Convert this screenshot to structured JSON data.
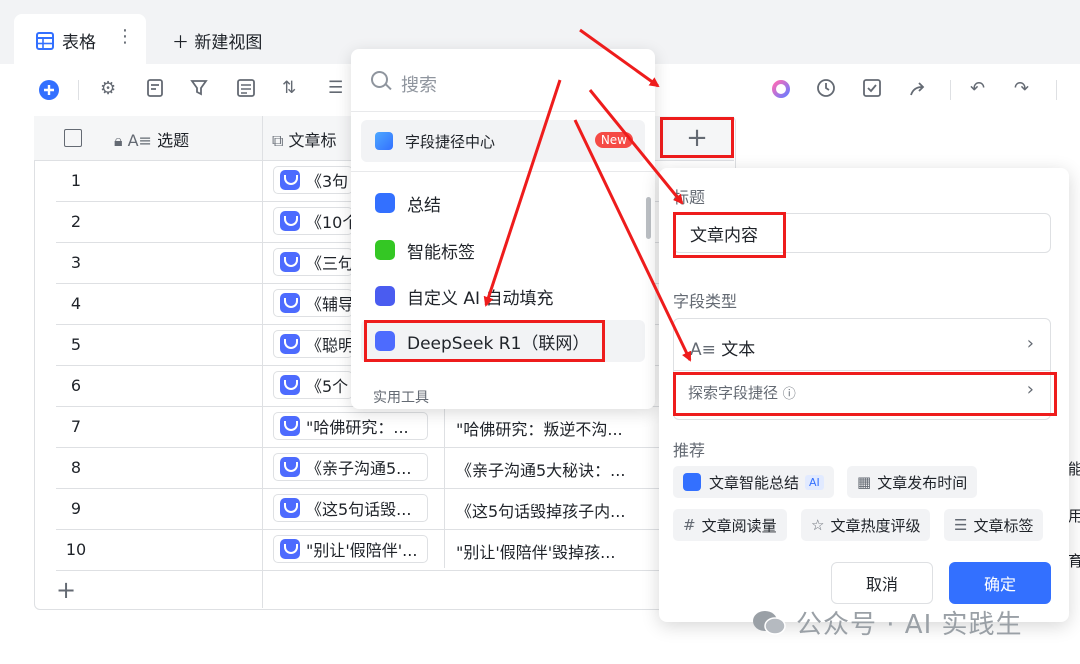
{
  "tabs": {
    "active_label": "表格",
    "new_view_label": "新建视图"
  },
  "table": {
    "header_topic": "选题",
    "header_title": "文章标",
    "rows": [
      {
        "num": "1",
        "title": "《3句"
      },
      {
        "num": "2",
        "title": "《10个"
      },
      {
        "num": "3",
        "title": "《三句"
      },
      {
        "num": "4",
        "title": "《辅导"
      },
      {
        "num": "5",
        "title": "《聪明"
      },
      {
        "num": "6",
        "title": "《5个"
      },
      {
        "num": "7",
        "title": "\"哈佛研究：...",
        "content": "\"哈佛研究：叛逆不沟..."
      },
      {
        "num": "8",
        "title": "《亲子沟通5...",
        "content": "《亲子沟通5大秘诀：..."
      },
      {
        "num": "9",
        "title": "《这5句话毁...",
        "content": "《这5句话毁掉孩子内..."
      },
      {
        "num": "10",
        "title": "\"别让'假陪伴'...",
        "content": "\"别让'假陪伴'毁掉孩..."
      }
    ],
    "add_row": "+",
    "clipped_right": [
      "能",
      "用",
      "育"
    ]
  },
  "menu": {
    "search_placeholder": "搜索",
    "center": "字段捷径中心",
    "new_badge": "New",
    "items": [
      "总结",
      "智能标签",
      "自定义 AI 自动填充",
      "DeepSeek R1（联网）"
    ],
    "section": "实用工具"
  },
  "add_column": "+",
  "panel": {
    "title_label": "标题",
    "title_value": "文章内容",
    "type_label": "字段类型",
    "type_value": "文本",
    "explore": "探索字段捷径",
    "recommend_label": "推荐",
    "recommendations": [
      "文章智能总结",
      "文章发布时间",
      "文章阅读量",
      "文章热度评级",
      "文章标签"
    ],
    "ai_tag": "AI",
    "cancel": "取消",
    "confirm": "确定"
  },
  "watermark": "公众号 · AI 实践生",
  "colors": {
    "accent": "#3370ff",
    "highlight": "#ee1c1c",
    "deepseek": "#4d6bfe"
  }
}
